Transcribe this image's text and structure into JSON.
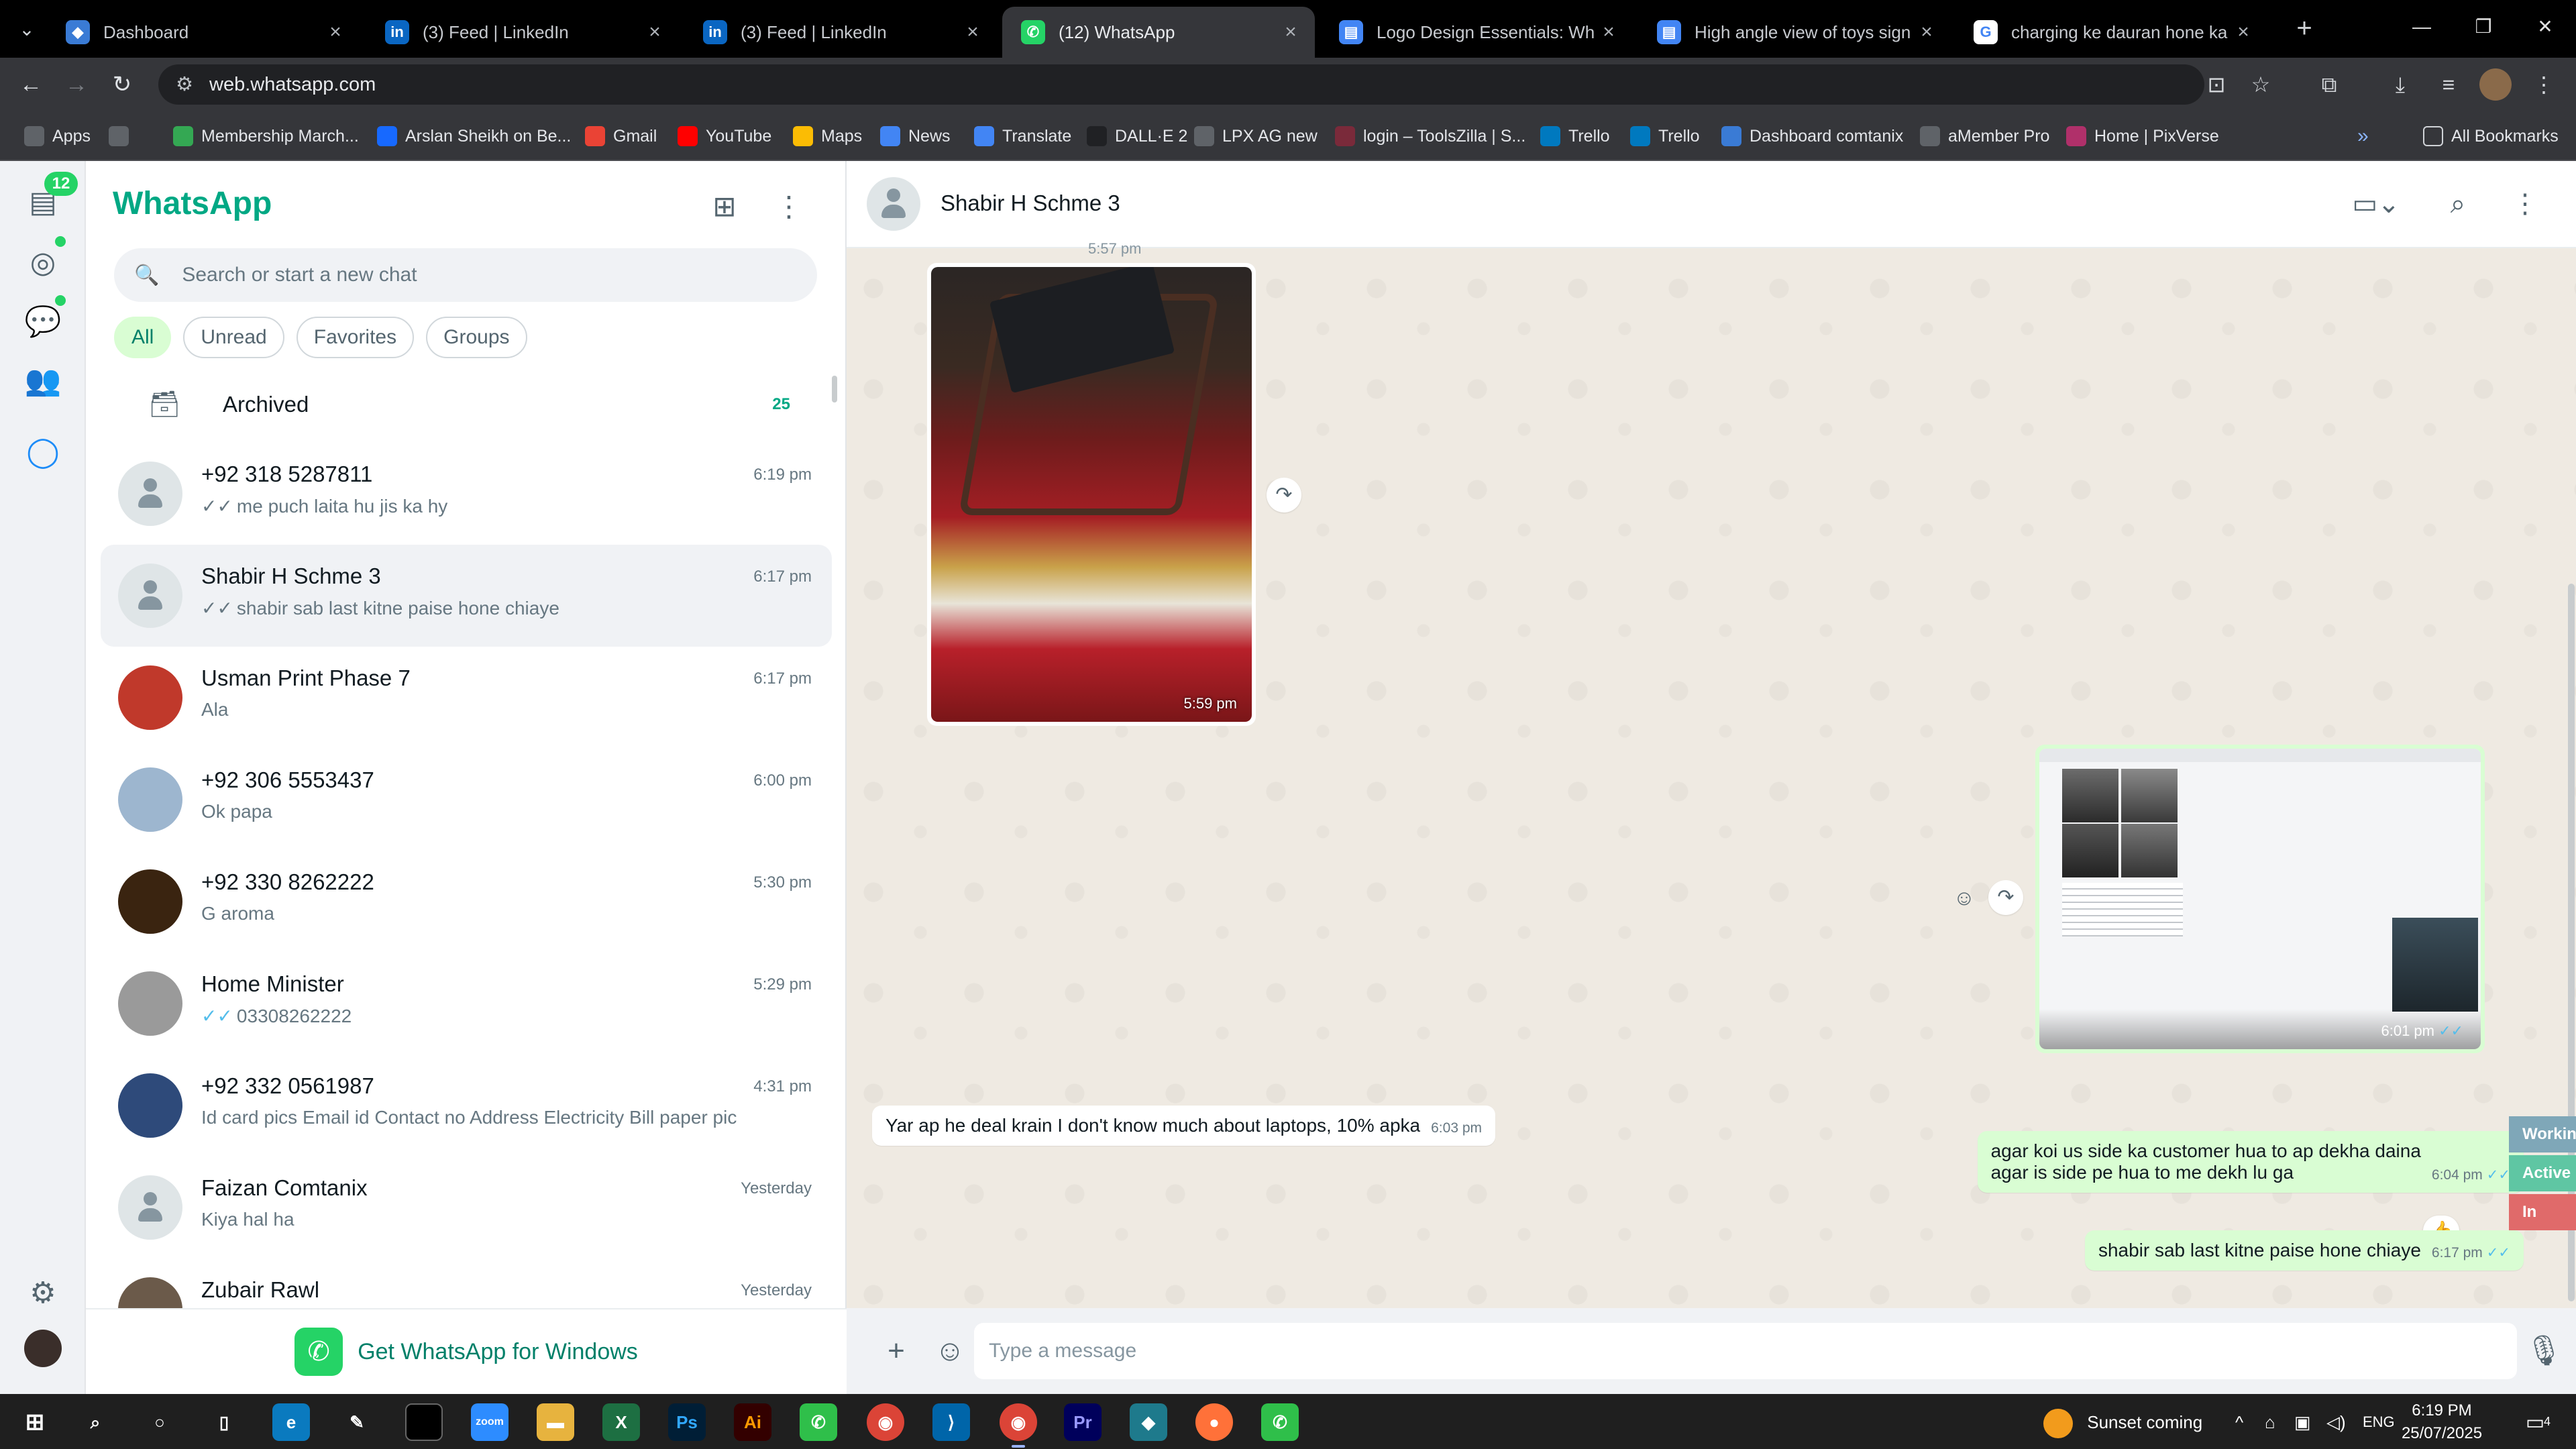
{
  "browser": {
    "tabs": [
      {
        "title": "Dashboard",
        "icon": "app-icon",
        "color": "#3a7bd5"
      },
      {
        "title": "(3) Feed | LinkedIn",
        "icon": "linkedin-icon",
        "color": "#0a66c2"
      },
      {
        "title": "(3) Feed | LinkedIn",
        "icon": "linkedin-icon",
        "color": "#0a66c2"
      },
      {
        "title": "(12) WhatsApp",
        "icon": "whatsapp-icon",
        "color": "#25d366"
      },
      {
        "title": "Logo Design Essentials: What t",
        "icon": "document-icon",
        "color": "#4285f4"
      },
      {
        "title": "High angle view of toys sign | F",
        "icon": "document-icon",
        "color": "#4285f4"
      },
      {
        "title": "charging ke dauran hone ka us",
        "icon": "google-icon",
        "color": "#ffffff"
      }
    ],
    "url": "web.whatsapp.com",
    "bookmarks": [
      {
        "label": "Apps",
        "color": "#5f6368"
      },
      {
        "label": "",
        "color": "#5f6368"
      },
      {
        "label": "Membership March...",
        "color": "#34a853"
      },
      {
        "label": "Arslan Sheikh on Be...",
        "color": "#1769ff"
      },
      {
        "label": "Gmail",
        "color": "#ea4335"
      },
      {
        "label": "YouTube",
        "color": "#ff0000"
      },
      {
        "label": "Maps",
        "color": "#fbbc04"
      },
      {
        "label": "News",
        "color": "#4285f4"
      },
      {
        "label": "Translate",
        "color": "#4285f4"
      },
      {
        "label": "DALL·E 2",
        "color": "#202124"
      },
      {
        "label": "LPX AG new",
        "color": "#5f6368"
      },
      {
        "label": "login – ToolsZilla | S...",
        "color": "#7a2a3a"
      },
      {
        "label": "Trello",
        "color": "#0079bf"
      },
      {
        "label": "Trello",
        "color": "#0079bf"
      },
      {
        "label": "Dashboard comtanix",
        "color": "#3a7bd5"
      },
      {
        "label": "aMember Pro",
        "color": "#5f6368"
      },
      {
        "label": "Home | PixVerse",
        "color": "#b0306a"
      }
    ],
    "all_bookmarks": "All Bookmarks"
  },
  "rail": {
    "badge": "12"
  },
  "sidebar": {
    "title": "WhatsApp",
    "search_placeholder": "Search or start a new chat",
    "filters": [
      "All",
      "Unread",
      "Favorites",
      "Groups"
    ],
    "archived_label": "Archived",
    "archived_count": "25",
    "chats": [
      {
        "name": "+92 318 5287811",
        "time": "6:19 pm",
        "preview": "me puch laita hu jis ka hy",
        "ticks": "grey",
        "avatar": "default",
        "selected": false
      },
      {
        "name": "Shabir H  Schme 3",
        "time": "6:17 pm",
        "preview": "shabir sab last kitne paise hone chiaye",
        "ticks": "grey",
        "avatar": "default",
        "selected": true
      },
      {
        "name": "Usman Print Phase 7",
        "time": "6:17 pm",
        "preview": "Ala",
        "ticks": "",
        "avatar": "#c0392b",
        "selected": false
      },
      {
        "name": "+92 306 5553437",
        "time": "6:00 pm",
        "preview": "Ok papa",
        "ticks": "",
        "avatar": "#9db6cf",
        "selected": false
      },
      {
        "name": "+92 330 8262222",
        "time": "5:30 pm",
        "preview": "G aroma",
        "ticks": "",
        "avatar": "#3a2410",
        "selected": false
      },
      {
        "name": "Home Minister",
        "time": "5:29 pm",
        "preview": "03308262222",
        "ticks": "blue",
        "avatar": "#9a9a9a",
        "selected": false
      },
      {
        "name": "+92 332 0561987",
        "time": "4:31 pm",
        "preview": "Id card pics Email id  Contact no Address Electricity Bill paper pic",
        "ticks": "",
        "avatar": "#2e4a7a",
        "selected": false
      },
      {
        "name": "Faizan Comtanix",
        "time": "Yesterday",
        "preview": "Kiya hal ha",
        "ticks": "",
        "avatar": "default",
        "selected": false
      },
      {
        "name": "Zubair Rawl",
        "time": "Yesterday",
        "preview": "",
        "ticks": "",
        "avatar": "#6b5a4a",
        "selected": false
      }
    ],
    "get_windows": "Get WhatsApp for Windows"
  },
  "conversation": {
    "contact": "Shabir H  Schme 3",
    "partial_time": "5:57 pm",
    "image_in_time": "5:59 pm",
    "image_out_time": "6:01 pm",
    "messages": [
      {
        "dir": "in",
        "text": "Yar ap he deal krain I don't know much about laptops, 10% apka",
        "time": "6:03 pm"
      },
      {
        "dir": "out",
        "text": "agar koi  us side ka customer hua to ap dekha daina\nagar is side pe hua to me dekh lu ga",
        "time": "6:04 pm",
        "reaction": "👍"
      },
      {
        "dir": "out",
        "text": "shabir sab last kitne paise hone chiaye",
        "time": "6:17 pm"
      }
    ],
    "compose_placeholder": "Type a message",
    "side_tabs": [
      {
        "label": "Working",
        "color": "#7fa7b8"
      },
      {
        "label": "Active",
        "color": "#5fc6a3"
      },
      {
        "label": "In Active",
        "color": "#e06a6a"
      }
    ]
  },
  "taskbar": {
    "weather": "Sunset coming",
    "lang": "ENG",
    "time": "6:19 PM",
    "date": "25/07/2025",
    "notifications": "4"
  }
}
